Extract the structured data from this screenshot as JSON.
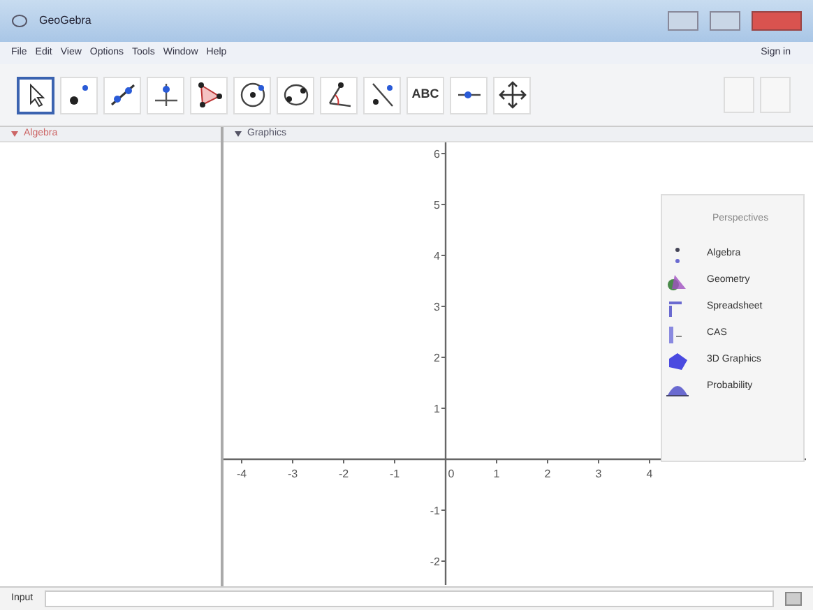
{
  "window": {
    "title": "GeoGebra"
  },
  "menu": [
    "File",
    "Edit",
    "View",
    "Options",
    "Tools",
    "Window",
    "Help"
  ],
  "sign_in": "Sign in",
  "tools": [
    {
      "kind": "move",
      "selected": true
    },
    {
      "kind": "point",
      "selected": false
    },
    {
      "kind": "line",
      "selected": false
    },
    {
      "kind": "perpendicular",
      "selected": false
    },
    {
      "kind": "polygon",
      "selected": false
    },
    {
      "kind": "circle",
      "selected": false
    },
    {
      "kind": "conic",
      "selected": false
    },
    {
      "kind": "angle",
      "selected": false
    },
    {
      "kind": "reflect",
      "selected": false
    },
    {
      "kind": "text",
      "label": "ABC",
      "selected": false
    },
    {
      "kind": "slider",
      "selected": false
    },
    {
      "kind": "pan",
      "selected": false
    }
  ],
  "algebra": {
    "title": "Algebra"
  },
  "graphics": {
    "title": "Graphics",
    "x_labels": [
      "-4",
      "-3",
      "-2",
      "-1",
      "0",
      "1",
      "2",
      "3",
      "4"
    ],
    "y_labels": [
      "6",
      "5",
      "4",
      "3",
      "2",
      "1",
      "-1",
      "-2"
    ]
  },
  "perspectives": {
    "title": "Perspectives",
    "items": [
      {
        "kind": "algebra",
        "label": "Algebra"
      },
      {
        "kind": "geometry",
        "label": "Geometry"
      },
      {
        "kind": "spreadsheet",
        "label": "Spreadsheet"
      },
      {
        "kind": "cas",
        "label": "CAS"
      },
      {
        "kind": "graphics3d",
        "label": "3D Graphics"
      },
      {
        "kind": "probability",
        "label": "Probability"
      }
    ]
  },
  "input_bar": {
    "label": "Input"
  }
}
